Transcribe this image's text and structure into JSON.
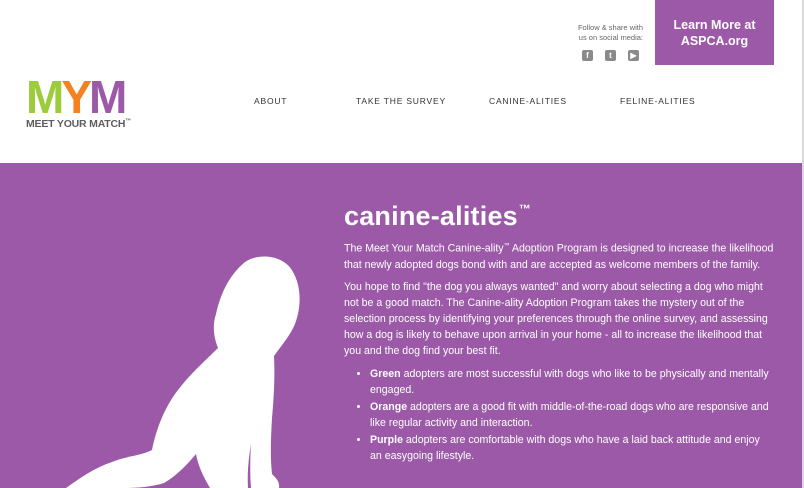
{
  "header": {
    "logo": {
      "letters": [
        {
          "char": "M",
          "color": "#9ccb3b"
        },
        {
          "char": "Y",
          "color": "#f58220"
        },
        {
          "char": "M",
          "color": "#9b59a8"
        }
      ],
      "subtitle": "MEET YOUR MATCH",
      "trademark": "™"
    },
    "social": {
      "text_line1": "Follow & share with",
      "text_line2": "us on social media:",
      "icons": [
        "facebook-icon",
        "twitter-icon",
        "youtube-icon"
      ]
    },
    "cta": {
      "line1": "Learn More at",
      "line2": "ASPCA.org"
    },
    "nav": [
      {
        "label": "ABOUT"
      },
      {
        "label": "TAKE THE SURVEY"
      },
      {
        "label": "CANINE-ALITIES"
      },
      {
        "label": "FELINE-ALITIES"
      }
    ]
  },
  "main": {
    "title": "canine-alities",
    "title_mark": "™",
    "paragraph1_before": "The Meet Your Match Canine-ality",
    "paragraph1_mark": "™",
    "paragraph1_after": " Adoption Program is designed to increase the likelihood that newly adopted dogs bond with and are accepted as welcome members of the family.",
    "paragraph2": "You hope to find \"the dog you always wanted\" and worry about selecting a dog who might not be a good match. The Canine-ality Adoption Program takes the mystery out of the selection process by identifying your preferences through the online survey, and assessing how a dog is likely to behave upon arrival in your home - all to increase the likelihood that you and the dog find your best fit.",
    "bullets": [
      {
        "term": "Green",
        "text": " adopters are most successful with dogs who like to be physically and mentally engaged."
      },
      {
        "term": "Orange",
        "text": " adopters are a good fit with middle-of-the-road dogs who are responsive and like regular activity and interaction."
      },
      {
        "term": "Purple",
        "text": " adopters are comfortable with dogs who have a laid back attitude and enjoy an easygoing lifestyle."
      }
    ]
  },
  "colors": {
    "brand_purple": "#9b59a8",
    "brand_green": "#9ccb3b",
    "brand_orange": "#f58220"
  }
}
